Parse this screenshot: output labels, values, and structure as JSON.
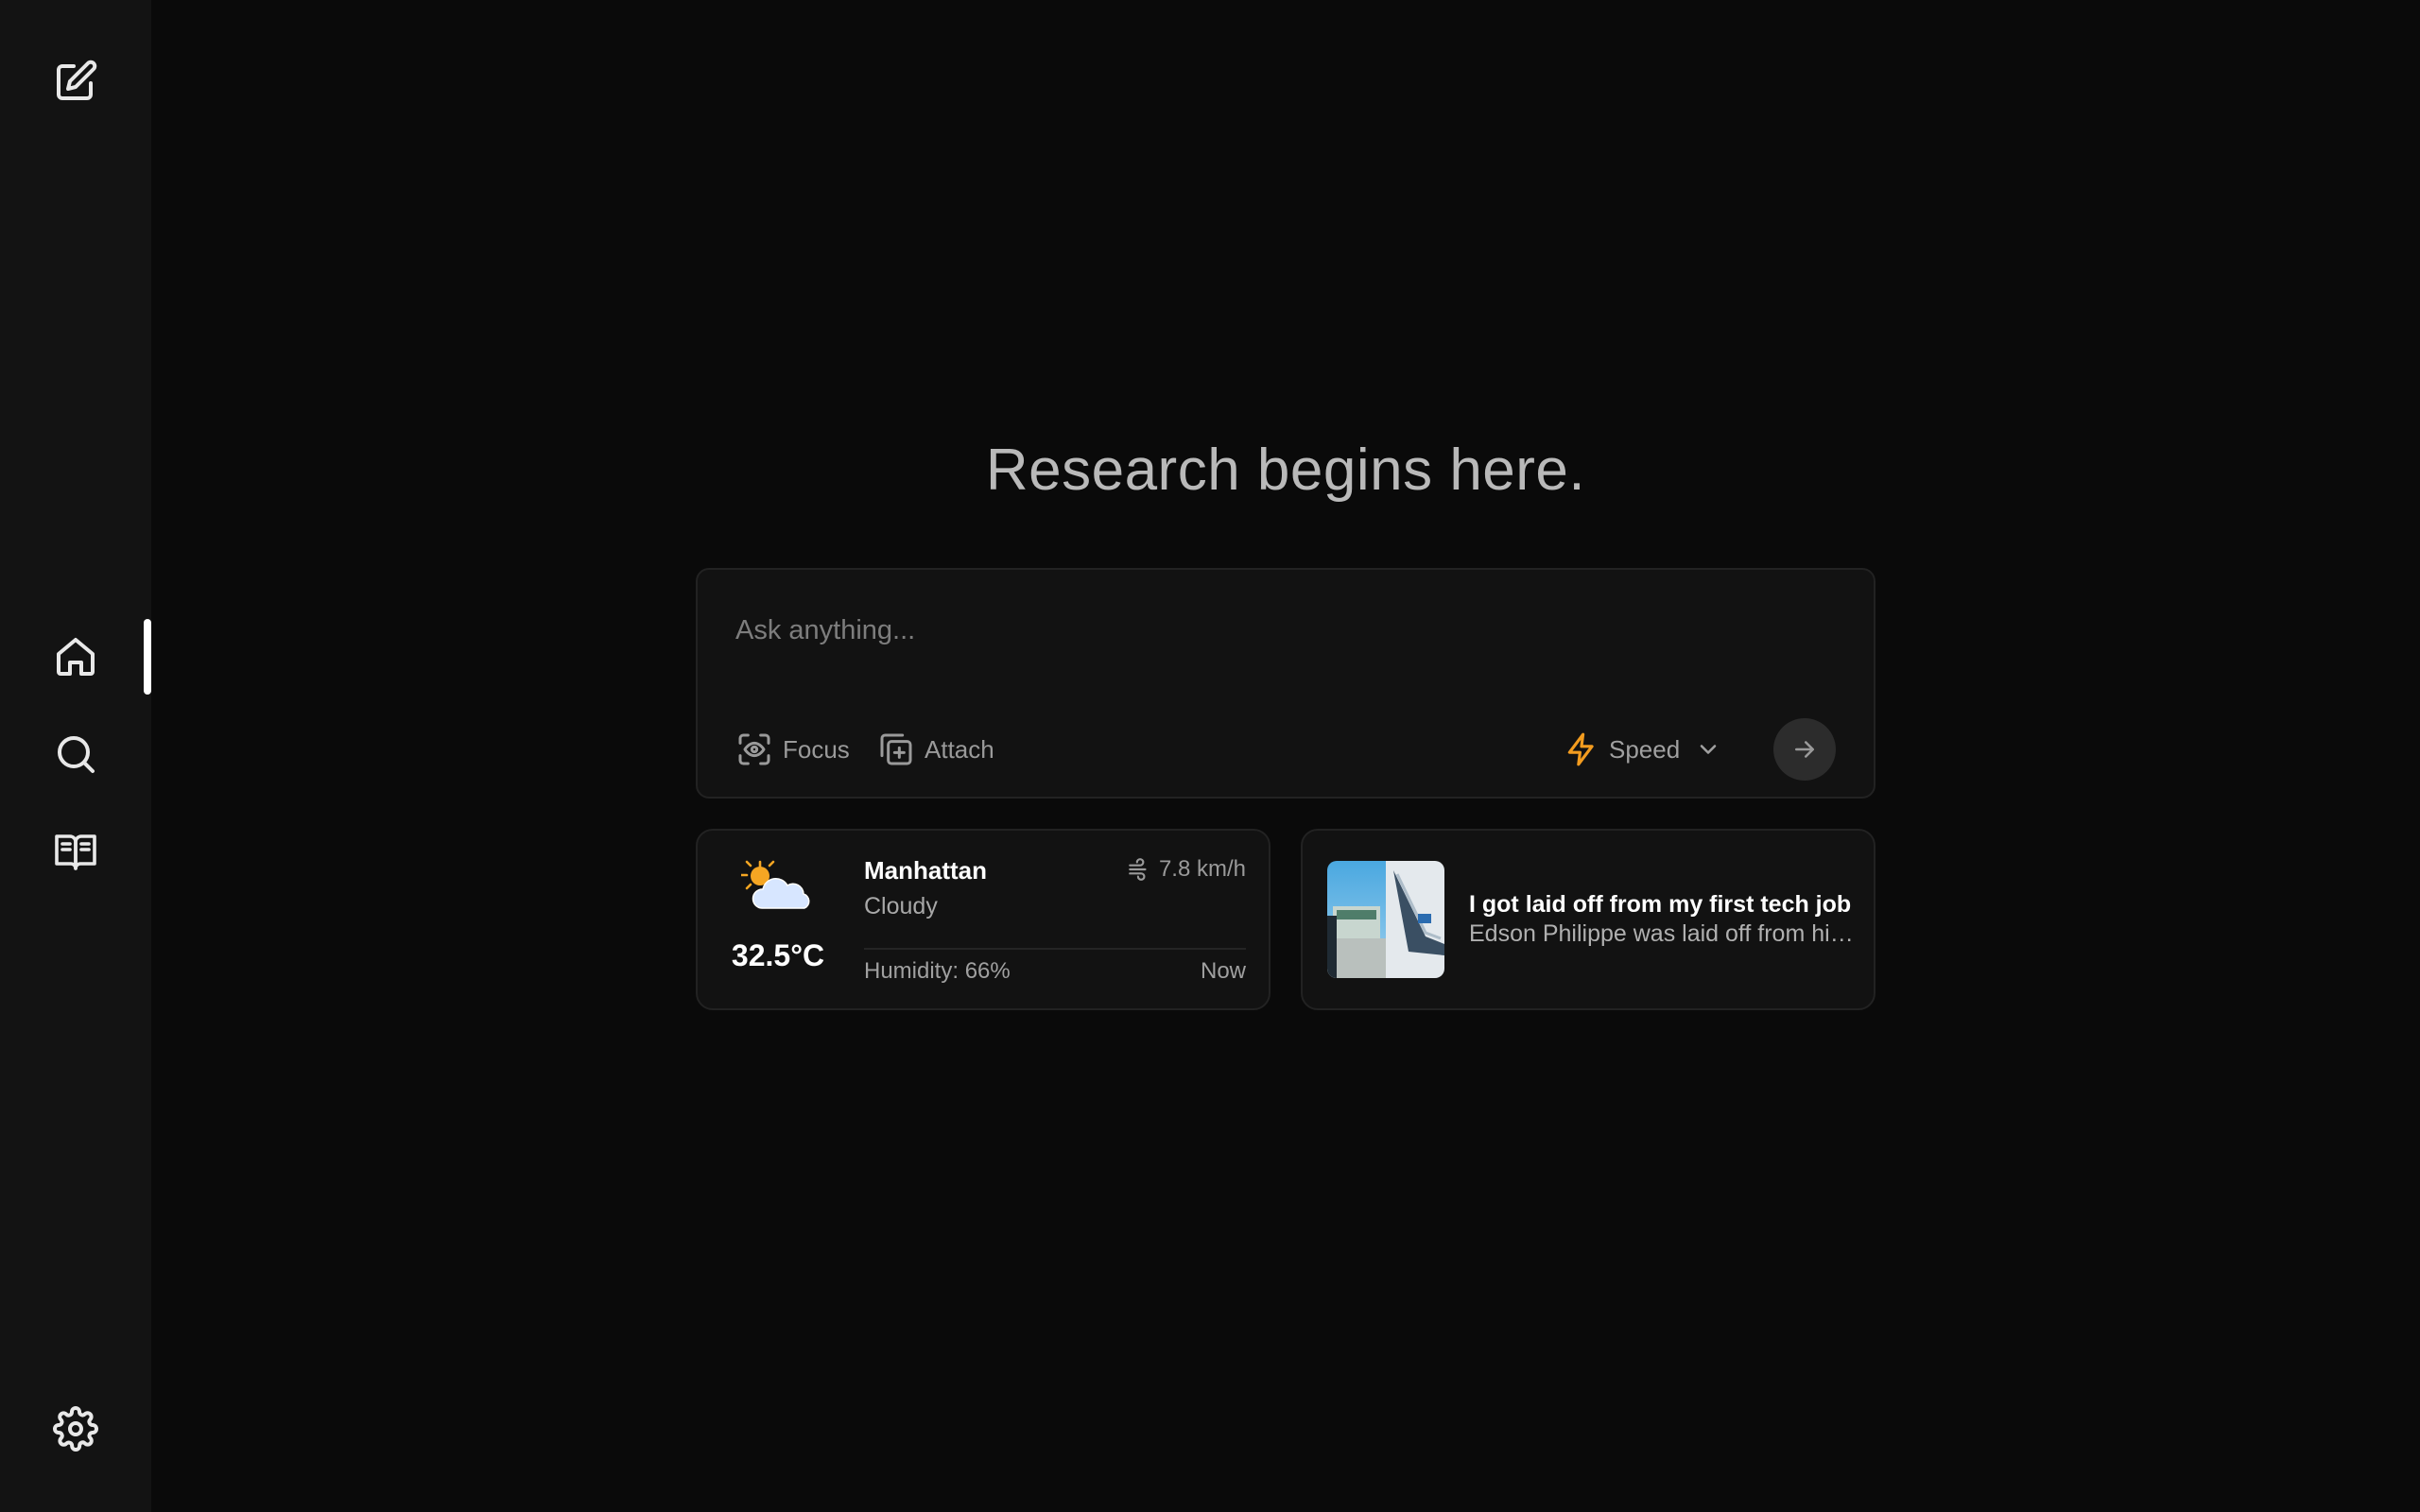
{
  "sidebar": {
    "items": [
      {
        "name": "new-chat",
        "icon": "edit-icon"
      },
      {
        "name": "home",
        "icon": "home-icon",
        "active": true
      },
      {
        "name": "discover",
        "icon": "search-icon"
      },
      {
        "name": "library",
        "icon": "book-open-icon"
      },
      {
        "name": "settings",
        "icon": "gear-icon"
      }
    ]
  },
  "main": {
    "heading": "Research begins here."
  },
  "search": {
    "placeholder": "Ask anything...",
    "value": "",
    "focus_label": "Focus",
    "attach_label": "Attach",
    "mode_label": "Speed",
    "send_icon": "arrow-right-icon"
  },
  "weather": {
    "city": "Manhattan",
    "condition": "Cloudy",
    "temperature": "32.5°C",
    "wind": "7.8 km/h",
    "humidity": "Humidity: 66%",
    "updated": "Now",
    "icon": "sun-cloud-icon"
  },
  "news": {
    "title": "I got laid off from my first tech job",
    "snippet": "Edson Philippe was laid off from his first tech job"
  },
  "colors": {
    "background": "#0a0a0a",
    "sidebar": "#131313",
    "card": "#121212",
    "accent_bolt": "#f39c1f",
    "sun": "#f5a623"
  }
}
